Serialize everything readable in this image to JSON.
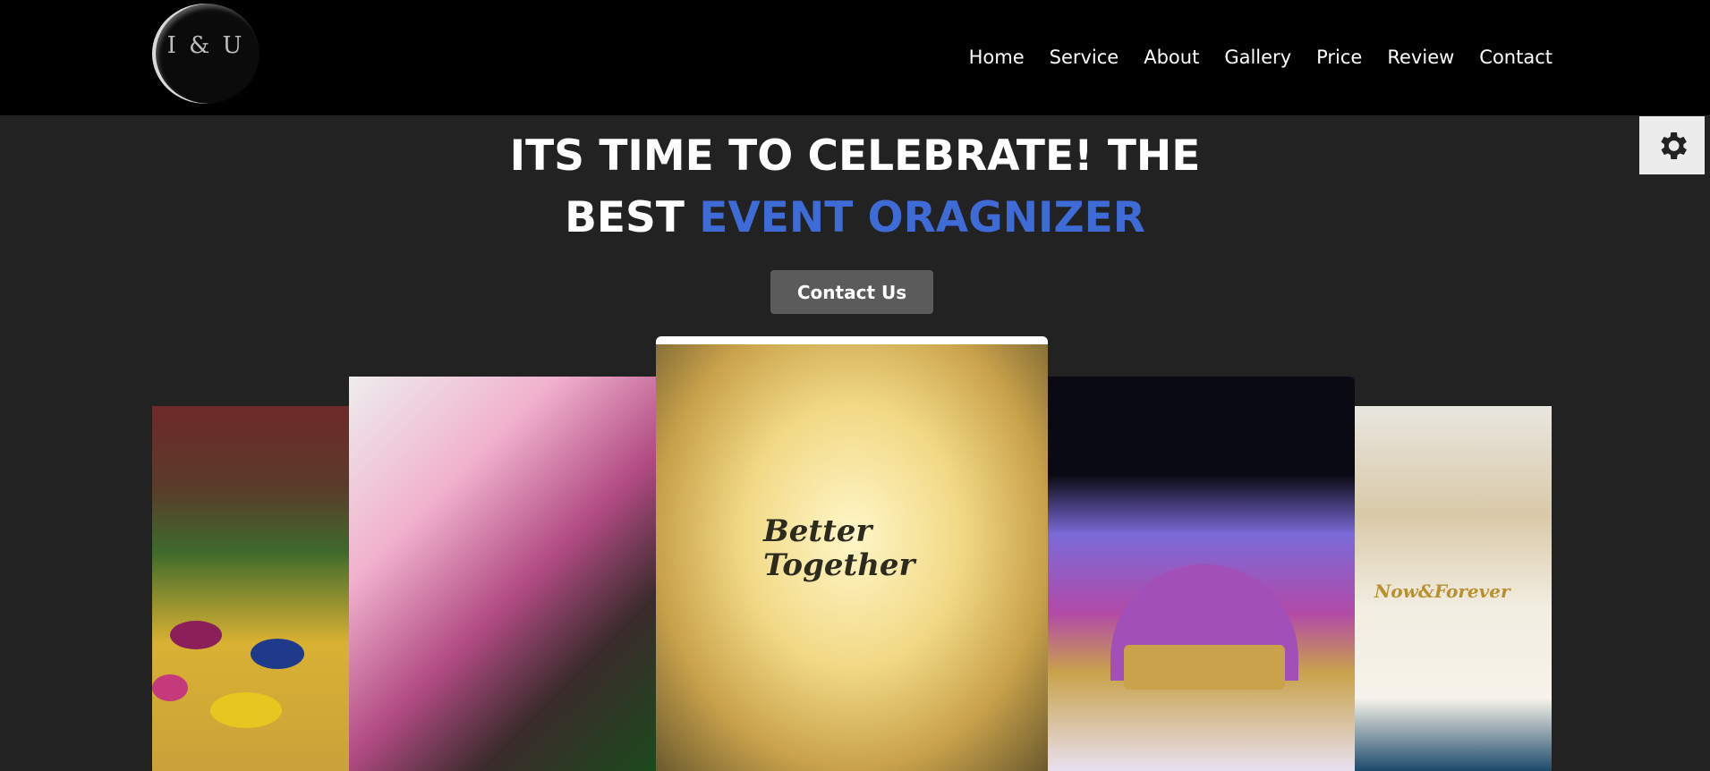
{
  "header": {
    "logo_text": "I & U",
    "nav": [
      "Home",
      "Service",
      "About",
      "Gallery",
      "Price",
      "Review",
      "Contact"
    ]
  },
  "hero": {
    "title_line1": "ITS TIME TO CELEBRATE! THE",
    "title_line2_plain": "BEST ",
    "title_line2_accent": "EVENT ORAGNIZER",
    "cta_label": "Contact Us"
  },
  "gallery": {
    "photo3_sign": "Better Together",
    "photo5_sign": "Now&Forever"
  },
  "colors": {
    "header_bg": "#000000",
    "page_bg": "#222222",
    "accent": "#3f6bd6",
    "cta_bg": "#5b5b5b"
  },
  "icons": {
    "settings": "gear-icon"
  }
}
